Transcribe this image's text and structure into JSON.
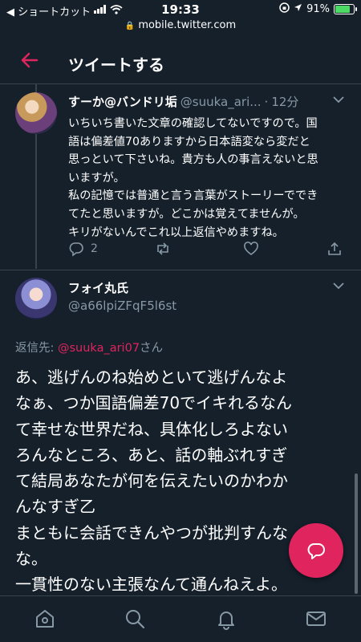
{
  "status_bar": {
    "back_app": "◀ ショートカット",
    "time": "19:33",
    "battery": "91%",
    "battery_level": 0.91
  },
  "url_bar": {
    "url": "mobile.twitter.com"
  },
  "header": {
    "title": "ツイートする"
  },
  "tweet1": {
    "name": "すーか@バンドリ垢",
    "handle": "@suuka_ari...",
    "time": "12分",
    "lines": [
      "いちいち書いた文章の確認してないですので。国",
      "語は偏差値70ありますから日本語変なら変だと",
      "思っといて下さいね。貴方も人の事言えないと思",
      "いますが。",
      "私の記憶では普通と言う言葉がストーリーででき",
      "てたと思いますが。どこかは覚えてませんが。",
      "キリがないんでこれ以上返信やめますね。"
    ],
    "reply_count": "2"
  },
  "tweet2": {
    "name": "フォイ丸氏",
    "handle": "@a66lpiZFqF5l6st",
    "reply_to_label": "返信先: ",
    "reply_to_mention": "@suuka_ari07",
    "reply_to_suffix": "さん",
    "lines": [
      "あ、逃げんのね始めといて逃げんなよ",
      "なぁ、つか国語偏差70でイキれるなん",
      "て幸せな世界だね、具体化しろよない",
      "ろんなところ、あと、話の軸ぶれすぎ",
      "て結局あなたが何を伝えたいのかわか",
      "んなすぎ乙",
      "まともに会話できんやつが批判すんな",
      "な。",
      "一貫性のない主張なんて通んねえよ。"
    ]
  },
  "colors": {
    "background": "#15202b",
    "accent": "#e0245e",
    "secondary_text": "#8899a6",
    "divider": "#38444d"
  },
  "icons": {
    "back": "arrow-left-icon",
    "reply": "reply-icon",
    "retweet": "retweet-icon",
    "like": "heart-icon",
    "share": "share-icon",
    "compose": "compose-icon",
    "home": "home-icon",
    "search": "search-icon",
    "notifications": "bell-icon",
    "messages": "mail-icon"
  }
}
